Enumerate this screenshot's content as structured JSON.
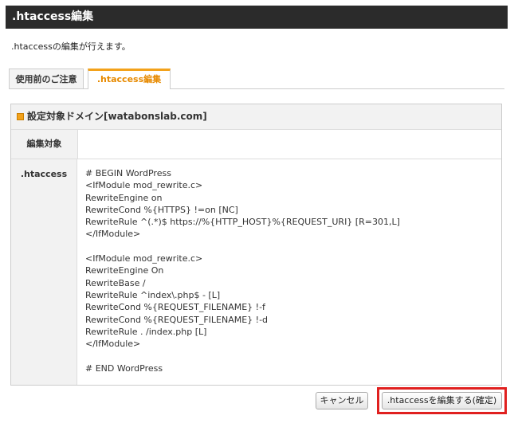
{
  "page": {
    "title": ".htaccess編集",
    "description": ".htaccessの編集が行えます。"
  },
  "tabs": [
    {
      "label": "使用前のご注意",
      "active": false
    },
    {
      "label": ".htaccess編集",
      "active": true
    }
  ],
  "panel": {
    "header_icon": "orange-square-icon",
    "header": "設定対象ドメイン[watabonslab.com]",
    "rows": [
      {
        "label": "編集対象",
        "value": ""
      },
      {
        "label": ".htaccess"
      }
    ],
    "htaccess_content": "# BEGIN WordPress\n<IfModule mod_rewrite.c>\nRewriteEngine on\nRewriteCond %{HTTPS} !=on [NC]\nRewriteRule ^(.*)$ https://%{HTTP_HOST}%{REQUEST_URI} [R=301,L]\n</IfModule>\n\n<IfModule mod_rewrite.c>\nRewriteEngine On\nRewriteBase /\nRewriteRule ^index\\.php$ - [L]\nRewriteCond %{REQUEST_FILENAME} !-f\nRewriteCond %{REQUEST_FILENAME} !-d\nRewriteRule . /index.php [L]\n</IfModule>\n\n# END WordPress"
  },
  "buttons": {
    "cancel": "キャンセル",
    "confirm": ".htaccessを編集する(確定)"
  },
  "colors": {
    "title_bar": "#2b2b2b",
    "accent": "#f3a21b",
    "active_tab_text": "#e78a00",
    "highlight": "#e0201f"
  }
}
